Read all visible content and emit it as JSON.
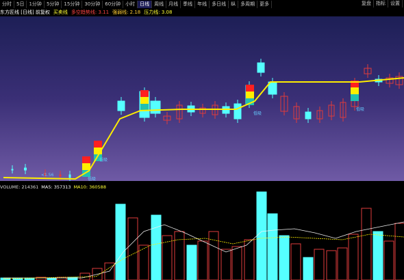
{
  "toolbar": {
    "items": [
      "分时",
      "5日",
      "1分钟",
      "5分钟",
      "15分钟",
      "30分钟",
      "60分钟",
      "小时",
      "日线",
      "周线",
      "月线",
      "季线",
      "年线",
      "多日线",
      "纵",
      "多周期",
      "更多"
    ],
    "active_index": 8,
    "right": [
      "复盘",
      "指标",
      "设置"
    ]
  },
  "title": {
    "name": "东方匠线 [日线] 前复权",
    "indicator": "买卖线",
    "line1": "多空趋势线: 3.11",
    "line2": "强弱线: 2.18",
    "line3": "压力线: 3.08"
  },
  "annotations": [
    "低吸",
    "低吸",
    "低吸",
    "低吸",
    "<1.56"
  ],
  "volume": {
    "label": "VOLUME: 214361",
    "ma5": "MA5: 357313",
    "ma10": "MA10: 360588"
  },
  "colors": {
    "up": "#e03b3b",
    "down": "#55ffff",
    "yellow_line": "#ffee00",
    "bg_top": "#1d1f56",
    "bg_bottom": "#6f5aa5"
  }
}
